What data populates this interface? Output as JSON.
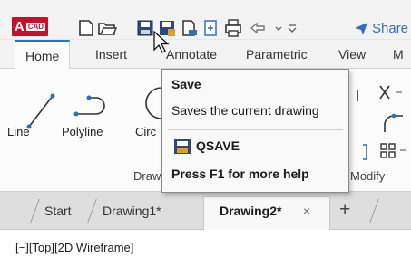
{
  "app": {
    "logo_letter": "A",
    "logo_tag": "CAD",
    "brand_color": "#c8102e"
  },
  "quick_access": {
    "icons": [
      "new-file-icon",
      "open-folder-icon",
      "save-icon",
      "save-as-icon",
      "open-from-web-icon",
      "export-icon",
      "plot-icon",
      "undo-icon",
      "customize-dropdown-icon"
    ],
    "share_label": "Share"
  },
  "ribbon": {
    "tabs": [
      "Home",
      "Insert",
      "Annotate",
      "Parametric",
      "View",
      "M"
    ],
    "active_tab": "Home",
    "draw": {
      "line_label": "Line",
      "polyline_label": "Polyline",
      "circle_label": "Circ",
      "panel_title": "Draw"
    },
    "modify": {
      "panel_title": "Modify"
    }
  },
  "tooltip": {
    "title": "Save",
    "description": "Saves the current drawing",
    "command": "QSAVE",
    "help": "Press F1 for more help"
  },
  "document_tabs": {
    "tabs": [
      "Start",
      "Drawing1*",
      "Drawing2*"
    ],
    "active": "Drawing2*",
    "close_glyph": "×",
    "add_glyph": "+"
  },
  "viewport": {
    "label": "[−][Top][2D Wireframe]"
  },
  "colors": {
    "accent": "#1f73d6",
    "share": "#2d6fc3"
  }
}
